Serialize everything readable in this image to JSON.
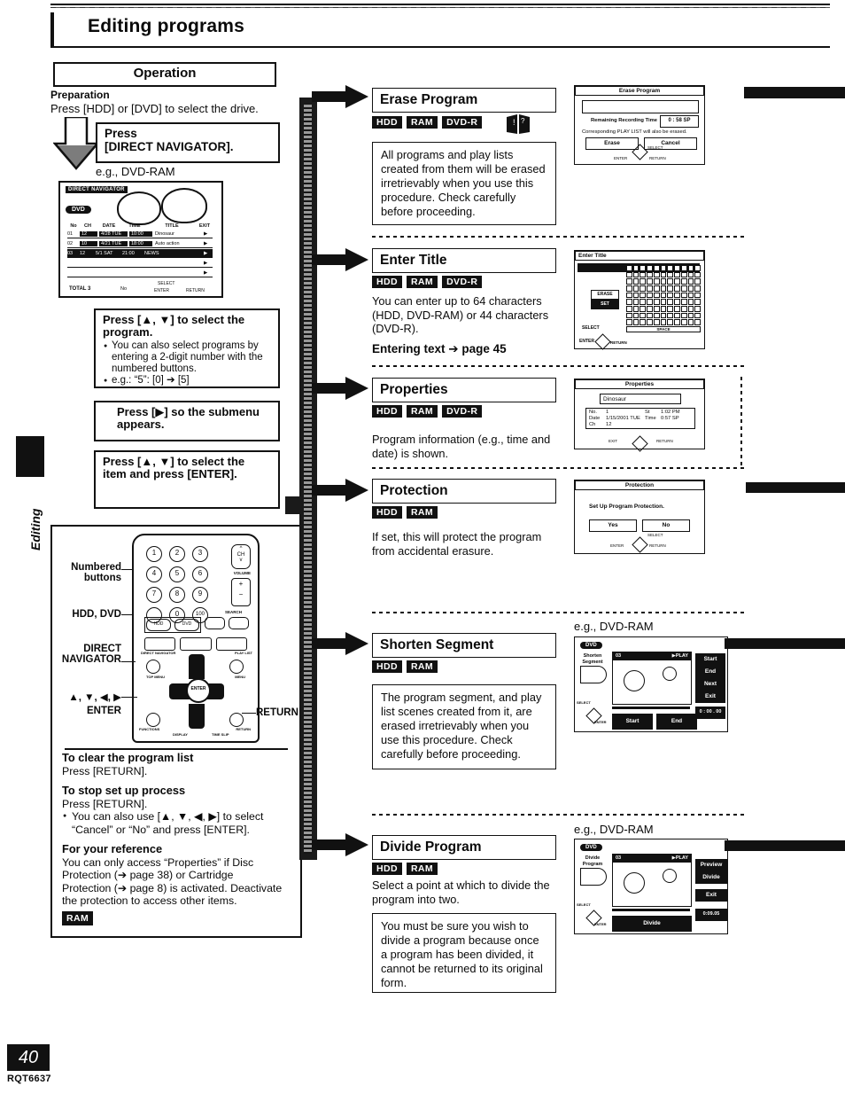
{
  "page": {
    "title": "Editing programs",
    "side_tab": "Editing",
    "page_number": "40",
    "doc_code": "RQT6637"
  },
  "operation": {
    "heading": "Operation",
    "preparation_title": "Preparation",
    "preparation_text": "Press [HDD] or [DVD] to select the drive.",
    "press_step": "Press\n[DIRECT NAVIGATOR].",
    "press_step_line1": "Press",
    "press_step_line2": "[DIRECT NAVIGATOR].",
    "eg_caption": "e.g., DVD-RAM",
    "steps": [
      {
        "title": "Press [▲, ▼] to select the program.",
        "bullets": [
          "You can also select programs by entering a 2-digit number with the numbered buttons.",
          "e.g.: “5”: [0] ➔ [5]"
        ]
      },
      {
        "title": "Press [▶] so the submenu appears.",
        "bullets": []
      },
      {
        "title": "Press [▲, ▼] to select the item and press [ENTER].",
        "bullets": []
      }
    ]
  },
  "direct_navigator_screen": {
    "tag": "DIRECT NAVIGATOR",
    "drive": "DVD",
    "columns": [
      "No",
      "CH",
      "DATE",
      "TIME",
      "TITLE",
      "EXIT"
    ],
    "rows": [
      {
        "no": "01",
        "ch": "12",
        "date": "4/28 TUE",
        "time": "10:00",
        "title": "Dinosaur"
      },
      {
        "no": "02",
        "ch": "10",
        "date": "4/21 TUE",
        "time": "18:00",
        "title": "Auto action"
      },
      {
        "no": "03",
        "ch": "12",
        "date": "5/1  SAT",
        "time": "21:00",
        "title": "NEWS"
      }
    ],
    "total": "TOTAL 3",
    "hint_no": "No",
    "hint_select": "SELECT",
    "hint_enter": "ENTER",
    "hint_return": "RETURN"
  },
  "remote": {
    "labels": {
      "numbered_buttons": "Numbered\nbuttons",
      "numbered_line1": "Numbered",
      "numbered_line2": "buttons",
      "hdd_dvd": "HDD, DVD",
      "direct_line1": "DIRECT",
      "direct_line2": "NAVIGATOR",
      "arrows": "▲, ▼, ◀, ▶",
      "enter": "ENTER",
      "return": "RETURN"
    },
    "keys": [
      "1",
      "2",
      "3",
      "4",
      "5",
      "6",
      "7",
      "8",
      "9",
      "0",
      "100"
    ],
    "ch_label": "CH",
    "volume_label": "VOLUME",
    "search_label": "SEARCH",
    "hdd_key": "HDD",
    "dvd_key": "DVD",
    "direct_nav_key": "DIRECT NAVIGATOR",
    "play_list_key": "PLAY LIST",
    "top_menu_key": "TOP MENU",
    "menu_key": "MENU",
    "functions_key": "FUNCTIONS",
    "return_key": "RETURN",
    "display_key": "DISPLAY",
    "timeslip_key": "TIME SLIP",
    "enter_key": "ENTER"
  },
  "notes": [
    {
      "heading": "To clear the program list",
      "text": "Press [RETURN].",
      "bullets": [],
      "tag": ""
    },
    {
      "heading": "To stop set up process",
      "text": "Press [RETURN].",
      "bullets": [
        "You can also use [▲, ▼, ◀, ▶] to select “Cancel” or “No” and press [ENTER]."
      ],
      "tag": ""
    },
    {
      "heading": "For your reference",
      "text": "You can only access “Properties” if Disc Protection (➔ page 38) or Cartridge Protection (➔ page 8) is activated. Deactivate the protection to access other items.",
      "bullets": [],
      "tag": "RAM"
    }
  ],
  "sections": [
    {
      "id": "erase-program",
      "title": "Erase Program",
      "tags": [
        "HDD",
        "RAM",
        "DVD-R"
      ],
      "note": "All programs and play lists created from them will be erased irretrievably when you use this procedure. Check carefully before proceeding.",
      "body": "",
      "caution_icon": "caution-book-icon"
    },
    {
      "id": "enter-title",
      "title": "Enter Title",
      "tags": [
        "HDD",
        "RAM",
        "DVD-R"
      ],
      "body": "You can enter up to 64 characters (HDD, DVD-RAM) or 44 characters (DVD-R).",
      "link": "Entering text ➔ page 45"
    },
    {
      "id": "properties",
      "title": "Properties",
      "tags": [
        "HDD",
        "RAM",
        "DVD-R"
      ],
      "body": "Program information (e.g., time and date) is shown."
    },
    {
      "id": "protection",
      "title": "Protection",
      "tags": [
        "HDD",
        "RAM"
      ],
      "body": "If set, this will protect the program from accidental erasure."
    },
    {
      "id": "shorten-segment",
      "title": "Shorten Segment",
      "tags": [
        "HDD",
        "RAM"
      ],
      "note": "The program segment, and play list scenes created from it, are erased irretrievably when you use this procedure. Check carefully before proceeding.",
      "eg_caption": "e.g., DVD-RAM"
    },
    {
      "id": "divide-program",
      "title": "Divide Program",
      "tags": [
        "HDD",
        "RAM"
      ],
      "body": "Select a point at which to divide the program into two.",
      "note": "You must be sure you wish to divide a program because once a program has been divided, it cannot be returned to its original form.",
      "eg_caption": "e.g., DVD-RAM"
    }
  ],
  "mockups": {
    "erase": {
      "title": "Erase Program",
      "remaining_label": "Remaining Recording Time",
      "remaining_value": "0 : 58 SP",
      "note": "Corresponding PLAY LIST will also be erased.",
      "buttons": [
        "Erase",
        "Cancel"
      ],
      "nav_hints": [
        "SELECT",
        "ENTER",
        "RETURN"
      ]
    },
    "enter_title": {
      "title": "Enter Title",
      "erase_btn": "ERASE",
      "set_btn": "SET",
      "space_btn": "SPACE",
      "select_hint": "SELECT",
      "enter_hint": "ENTER",
      "return_hint": "RETURN"
    },
    "properties": {
      "title": "Properties",
      "program_name": "Dinosaur",
      "fields": [
        {
          "label": "No.",
          "value": "1"
        },
        {
          "label": "Date",
          "value": "1/15/2001 TUE"
        },
        {
          "label": "Ch",
          "value": "12"
        },
        {
          "label": "St",
          "value": "1:02 PM"
        },
        {
          "label": "Time",
          "value": "0:57 SP"
        }
      ],
      "nav_hints": [
        "EXIT",
        "RETURN"
      ]
    },
    "protection": {
      "title": "Protection",
      "message": "Set Up Program Protection.",
      "buttons": [
        "Yes",
        "No"
      ],
      "nav_hints": [
        "SELECT",
        "ENTER",
        "RETURN"
      ]
    },
    "shorten": {
      "drive": "DVD",
      "mode_line1": "Shorten",
      "mode_line2": "Segment",
      "program": "03",
      "state": "▶PLAY",
      "buttons": [
        "Start",
        "End",
        "Next",
        "Exit"
      ],
      "time": "0 : 00 . 00",
      "bottom_left_btn": "Start",
      "bottom_right_btn": "End",
      "nav_select": "SELECT",
      "nav_enter": "ENTER"
    },
    "divide": {
      "drive": "DVD",
      "mode_line1": "Divide",
      "mode_line2": "Program",
      "program": "03",
      "state": "▶PLAY",
      "buttons": [
        "Preview",
        "Divide",
        "Exit"
      ],
      "time": "0:09.05",
      "bottom_btn": "Divide",
      "nav_select": "SELECT",
      "nav_enter": "ENTER"
    }
  }
}
